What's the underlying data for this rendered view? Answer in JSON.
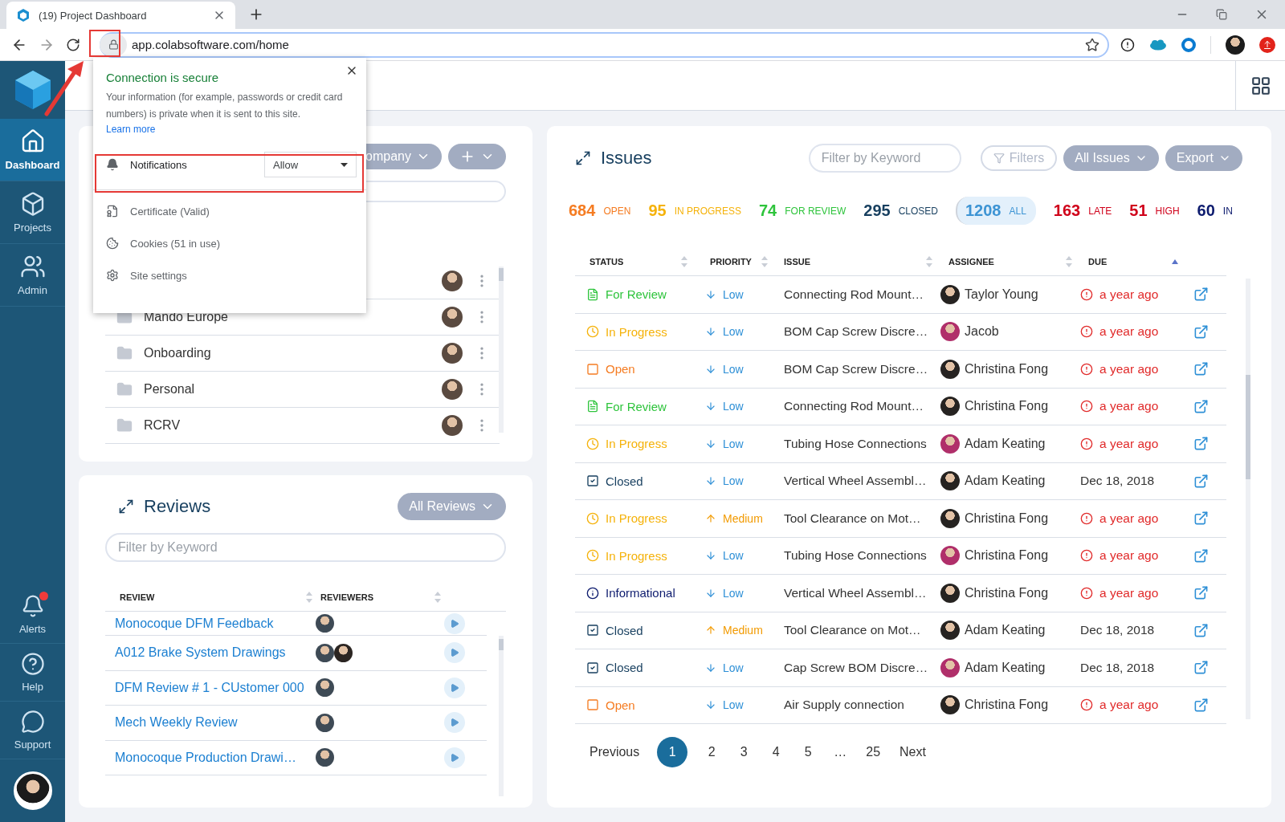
{
  "browser": {
    "tab_title": "(19) Project Dashboard",
    "url": "app.colabsoftware.com/home"
  },
  "sidebar": {
    "items": [
      {
        "label": "Dashboard",
        "kind": "home",
        "selected": true
      },
      {
        "label": "Projects",
        "kind": "box",
        "selected": false
      },
      {
        "label": "Admin",
        "kind": "users",
        "selected": false
      }
    ],
    "bottom_items": [
      {
        "label": "Alerts",
        "kind": "bell",
        "badge": true
      },
      {
        "label": "Help",
        "kind": "help",
        "badge": false
      },
      {
        "label": "Support",
        "kind": "chat",
        "badge": false
      }
    ]
  },
  "site_info_popup": {
    "title": "Connection is secure",
    "body": "Your information (for example, passwords or credit card numbers) is private when it is sent to this site.",
    "link": "Learn more",
    "permission": {
      "label": "Notifications",
      "value": "Allow"
    },
    "items": [
      {
        "kind": "certificate",
        "label": "Certificate (Valid)"
      },
      {
        "kind": "cookies",
        "label": "Cookies (51 in use)"
      },
      {
        "kind": "settings",
        "label": "Site settings"
      }
    ]
  },
  "projects": {
    "company_button": "ompany",
    "rows": [
      {},
      {
        "name": "Mando Europe"
      },
      {
        "name": "Onboarding"
      },
      {
        "name": "Personal"
      },
      {
        "name": "RCRV"
      }
    ]
  },
  "reviews": {
    "title": "Reviews",
    "filter_button": "All Reviews",
    "search_placeholder": "Filter by Keyword",
    "columns": [
      "REVIEW",
      "REVIEWERS"
    ],
    "rows": [
      {
        "name": "Monocoque DFM Feedback",
        "reviewers": [
          {
            "kind": "photo"
          }
        ]
      },
      {
        "name": "A012 Brake System Drawings",
        "reviewers": [
          {
            "kind": "photo"
          },
          {
            "kind": "photo"
          }
        ]
      },
      {
        "name": "DFM Review # 1 - CUstomer 000",
        "reviewers": [
          {
            "kind": "photo"
          }
        ]
      },
      {
        "name": "Mech Weekly Review",
        "reviewers": [
          {
            "kind": "photo"
          }
        ]
      },
      {
        "name": "Monocoque Production Drawi…",
        "reviewers": [
          {
            "kind": "photo"
          }
        ]
      }
    ]
  },
  "issues": {
    "title": "Issues",
    "search_placeholder": "Filter by Keyword",
    "filters_button": "Filters",
    "scope_button": "All Issues",
    "export_button": "Export",
    "counts": [
      {
        "number": "684",
        "label": "OPEN",
        "color": "#f57c22",
        "selected": false
      },
      {
        "number": "95",
        "label": "IN PROGRESS",
        "color": "#f5b20a",
        "selected": false
      },
      {
        "number": "74",
        "label": "FOR REVIEW",
        "color": "#2ec43c",
        "selected": false
      },
      {
        "number": "295",
        "label": "CLOSED",
        "color": "#173f5f",
        "selected": false
      },
      {
        "number": "1208",
        "label": "ALL",
        "color": "#3d94d4",
        "selected": true
      },
      {
        "number": "163",
        "label": "LATE",
        "color": "#d0021b",
        "selected": false
      },
      {
        "number": "51",
        "label": "HIGH",
        "color": "#d0021b",
        "selected": false
      },
      {
        "number": "60",
        "label": "IN",
        "color": "#0d1b6e",
        "selected": false
      }
    ],
    "columns": [
      "STATUS",
      "PRIORITY",
      "ISSUE",
      "ASSIGNEE",
      "DUE"
    ],
    "rows": [
      {
        "status": {
          "label": "For Review",
          "kind": "review"
        },
        "priority": {
          "label": "Low",
          "kind": "low"
        },
        "issue": "Connecting Rod Mount…",
        "assignee": "Taylor Young",
        "due": "a year ago",
        "late": true
      },
      {
        "status": {
          "label": "In Progress",
          "kind": "progress"
        },
        "priority": {
          "label": "Low",
          "kind": "low"
        },
        "issue": "BOM Cap Screw Discre…",
        "assignee": "Jacob",
        "due": "a year ago",
        "late": true
      },
      {
        "status": {
          "label": "Open",
          "kind": "open"
        },
        "priority": {
          "label": "Low",
          "kind": "low"
        },
        "issue": "BOM Cap Screw Discre…",
        "assignee": "Christina Fong",
        "due": "a year ago",
        "late": true
      },
      {
        "status": {
          "label": "For Review",
          "kind": "review"
        },
        "priority": {
          "label": "Low",
          "kind": "low"
        },
        "issue": "Connecting Rod Mount…",
        "assignee": "Christina Fong",
        "due": "a year ago",
        "late": true
      },
      {
        "status": {
          "label": "In Progress",
          "kind": "progress"
        },
        "priority": {
          "label": "Low",
          "kind": "low"
        },
        "issue": "Tubing Hose Connections",
        "assignee": "Adam Keating",
        "due": "a year ago",
        "late": true
      },
      {
        "status": {
          "label": "Closed",
          "kind": "closed"
        },
        "priority": {
          "label": "Low",
          "kind": "low"
        },
        "issue": "Vertical Wheel Assembl…",
        "assignee": "Adam Keating",
        "due": "Dec 18, 2018",
        "late": false
      },
      {
        "status": {
          "label": "In Progress",
          "kind": "progress"
        },
        "priority": {
          "label": "Medium",
          "kind": "medium"
        },
        "issue": "Tool Clearance on Mot…",
        "assignee": "Christina Fong",
        "due": "a year ago",
        "late": true
      },
      {
        "status": {
          "label": "In Progress",
          "kind": "progress"
        },
        "priority": {
          "label": "Low",
          "kind": "low"
        },
        "issue": "Tubing Hose Connections",
        "assignee": "Christina Fong",
        "due": "a year ago",
        "late": true
      },
      {
        "status": {
          "label": "Informational",
          "kind": "info"
        },
        "priority": {
          "label": "Low",
          "kind": "low"
        },
        "issue": "Vertical Wheel Assembl…",
        "assignee": "Christina Fong",
        "due": "a year ago",
        "late": true
      },
      {
        "status": {
          "label": "Closed",
          "kind": "closed"
        },
        "priority": {
          "label": "Medium",
          "kind": "medium"
        },
        "issue": "Tool Clearance on Mot…",
        "assignee": "Adam Keating",
        "due": "Dec 18, 2018",
        "late": false
      },
      {
        "status": {
          "label": "Closed",
          "kind": "closed"
        },
        "priority": {
          "label": "Low",
          "kind": "low"
        },
        "issue": "Cap Screw BOM Discre…",
        "assignee": "Adam Keating",
        "due": "Dec 18, 2018",
        "late": false
      },
      {
        "status": {
          "label": "Open",
          "kind": "open"
        },
        "priority": {
          "label": "Low",
          "kind": "low"
        },
        "issue": "Air Supply connection",
        "assignee": "Christina Fong",
        "due": "a year ago",
        "late": true
      }
    ],
    "pagination": {
      "previous": "Previous",
      "next": "Next",
      "pages": [
        {
          "label": "1",
          "selected": true
        },
        {
          "label": "2",
          "selected": false
        },
        {
          "label": "3",
          "selected": false
        },
        {
          "label": "4",
          "selected": false
        },
        {
          "label": "5",
          "selected": false
        },
        {
          "label": "…",
          "selected": false
        },
        {
          "label": "25",
          "selected": false
        }
      ]
    }
  }
}
